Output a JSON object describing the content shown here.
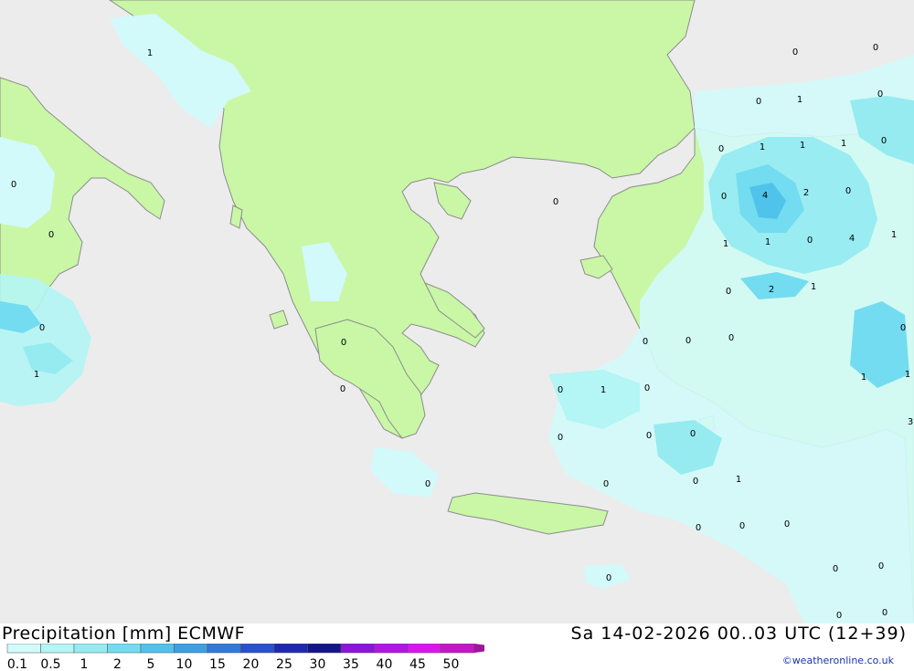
{
  "title": "Precipitation [mm] ECMWF",
  "datetime": "Sa 14-02-2026 00..03 UTC (12+39)",
  "credit": "©weatheronline.co.uk",
  "legend": {
    "ticks": [
      "0.1",
      "0.5",
      "1",
      "2",
      "5",
      "10",
      "15",
      "20",
      "25",
      "30",
      "35",
      "40",
      "45",
      "50"
    ],
    "colors": [
      "#d2fafa",
      "#b4f5f5",
      "#96ebf0",
      "#73dcf0",
      "#50c3eb",
      "#3ca0e6",
      "#3278dc",
      "#2850d2",
      "#1e28b4",
      "#14148c",
      "#8c14dc",
      "#b414e6",
      "#dc14f0",
      "#c814c8",
      "#a014a0"
    ]
  },
  "map": {
    "colors": {
      "sea": "#ececec",
      "land": "#c9f7a6",
      "border": "#8c8c8c"
    },
    "values": [
      {
        "text": "1"
      },
      {
        "text": "0"
      },
      {
        "text": "0"
      },
      {
        "text": "0"
      },
      {
        "text": "0"
      },
      {
        "text": "1"
      },
      {
        "text": "0"
      },
      {
        "text": "0"
      },
      {
        "text": "0"
      },
      {
        "text": "0"
      },
      {
        "text": "0"
      },
      {
        "text": "0"
      },
      {
        "text": "0"
      },
      {
        "text": "0"
      },
      {
        "text": "1"
      },
      {
        "text": "0"
      },
      {
        "text": "0"
      },
      {
        "text": "1"
      },
      {
        "text": "0"
      },
      {
        "text": "1"
      },
      {
        "text": "1"
      },
      {
        "text": "1"
      },
      {
        "text": "0"
      },
      {
        "text": "0"
      },
      {
        "text": "4"
      },
      {
        "text": "2"
      },
      {
        "text": "0"
      },
      {
        "text": "1"
      },
      {
        "text": "1"
      },
      {
        "text": "0"
      },
      {
        "text": "4"
      },
      {
        "text": "1"
      },
      {
        "text": "0"
      },
      {
        "text": "2"
      },
      {
        "text": "1"
      },
      {
        "text": "0"
      },
      {
        "text": "0"
      },
      {
        "text": "0"
      },
      {
        "text": "1"
      },
      {
        "text": "1"
      },
      {
        "text": "0"
      },
      {
        "text": "0"
      },
      {
        "text": "0"
      },
      {
        "text": "0"
      },
      {
        "text": "1"
      },
      {
        "text": "0"
      },
      {
        "text": "0"
      },
      {
        "text": "0"
      },
      {
        "text": "0"
      },
      {
        "text": "0"
      },
      {
        "text": "0"
      },
      {
        "text": "0"
      },
      {
        "text": "3"
      },
      {
        "text": "0"
      },
      {
        "text": "0"
      }
    ]
  }
}
